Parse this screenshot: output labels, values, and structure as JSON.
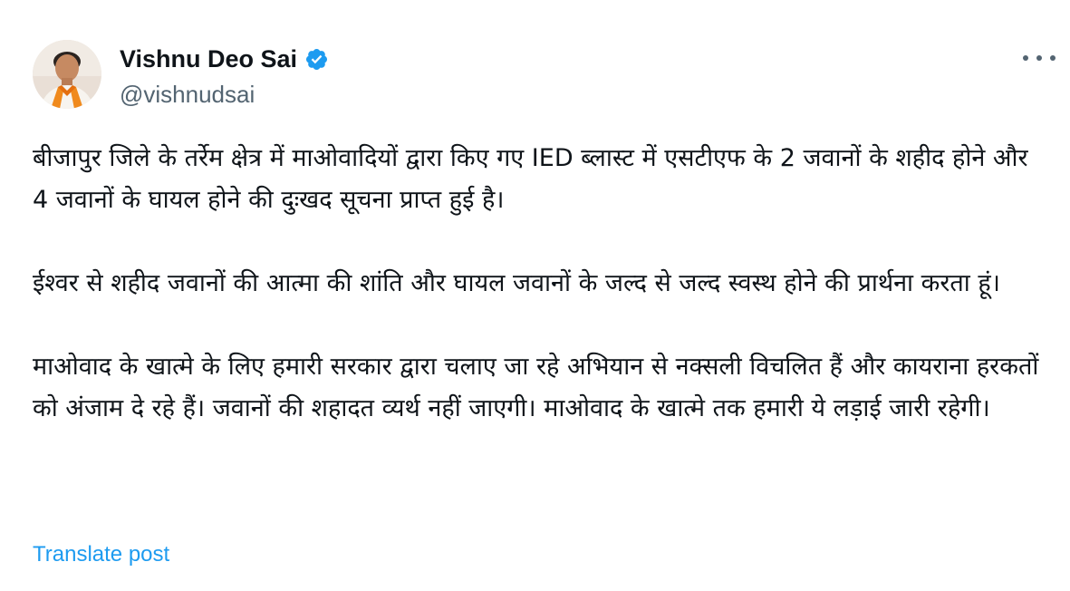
{
  "author": {
    "display_name": "Vishnu Deo Sai",
    "handle": "@vishnudsai",
    "verified": true,
    "verified_icon": "verified-badge-icon",
    "avatar_icon": "profile-avatar"
  },
  "post": {
    "paragraphs": [
      "बीजापुर जिले के तर्रेम क्षेत्र में माओवादियों द्वारा किए गए IED ब्लास्ट में एसटीएफ के 2 जवानों के शहीद होने और 4 जवानों के घायल होने की दुःखद सूचना प्राप्त हुई है।",
      "ईश्वर से शहीद जवानों की आत्मा की शांति और घायल जवानों के जल्द से जल्द स्वस्थ होने की प्रार्थना करता हूं।",
      "माओवाद के खात्मे के लिए हमारी सरकार द्वारा चलाए जा रहे अभियान से नक्सली विचलित हैं और कायराना हरकतों को अंजाम दे रहे हैं। जवानों की शहादत व्यर्थ नहीं जाएगी। माओवाद के खात्मे तक हमारी ये लड़ाई जारी रहेगी।"
    ],
    "translate_label": "Translate post"
  },
  "colors": {
    "accent": "#1d9bf0",
    "secondary_text": "#536471",
    "primary_text": "#0f1419"
  }
}
